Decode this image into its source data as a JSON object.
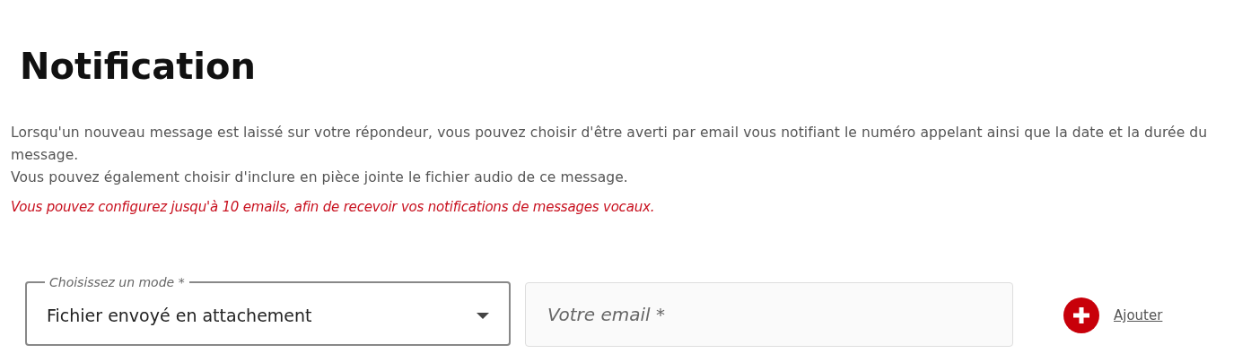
{
  "title": "Notification",
  "paragraphs": [
    "Lorsqu'un nouveau message est laissé sur votre répondeur, vous pouvez choisir d'être averti par email vous notifiant le numéro appelant ainsi que la date et la durée du message.",
    "Vous pouvez également choisir d'inclure en pièce jointe le fichier audio de ce message."
  ],
  "notice": "Vous pouvez configurez jusqu'à 10 emails, afin de recevoir vos notifications de messages vocaux.",
  "mode_select": {
    "label": "Choisissez un mode *",
    "value": "Fichier envoyé en attachement"
  },
  "email_field": {
    "placeholder": "Votre email *"
  },
  "add_link": {
    "label": "Ajouter"
  }
}
